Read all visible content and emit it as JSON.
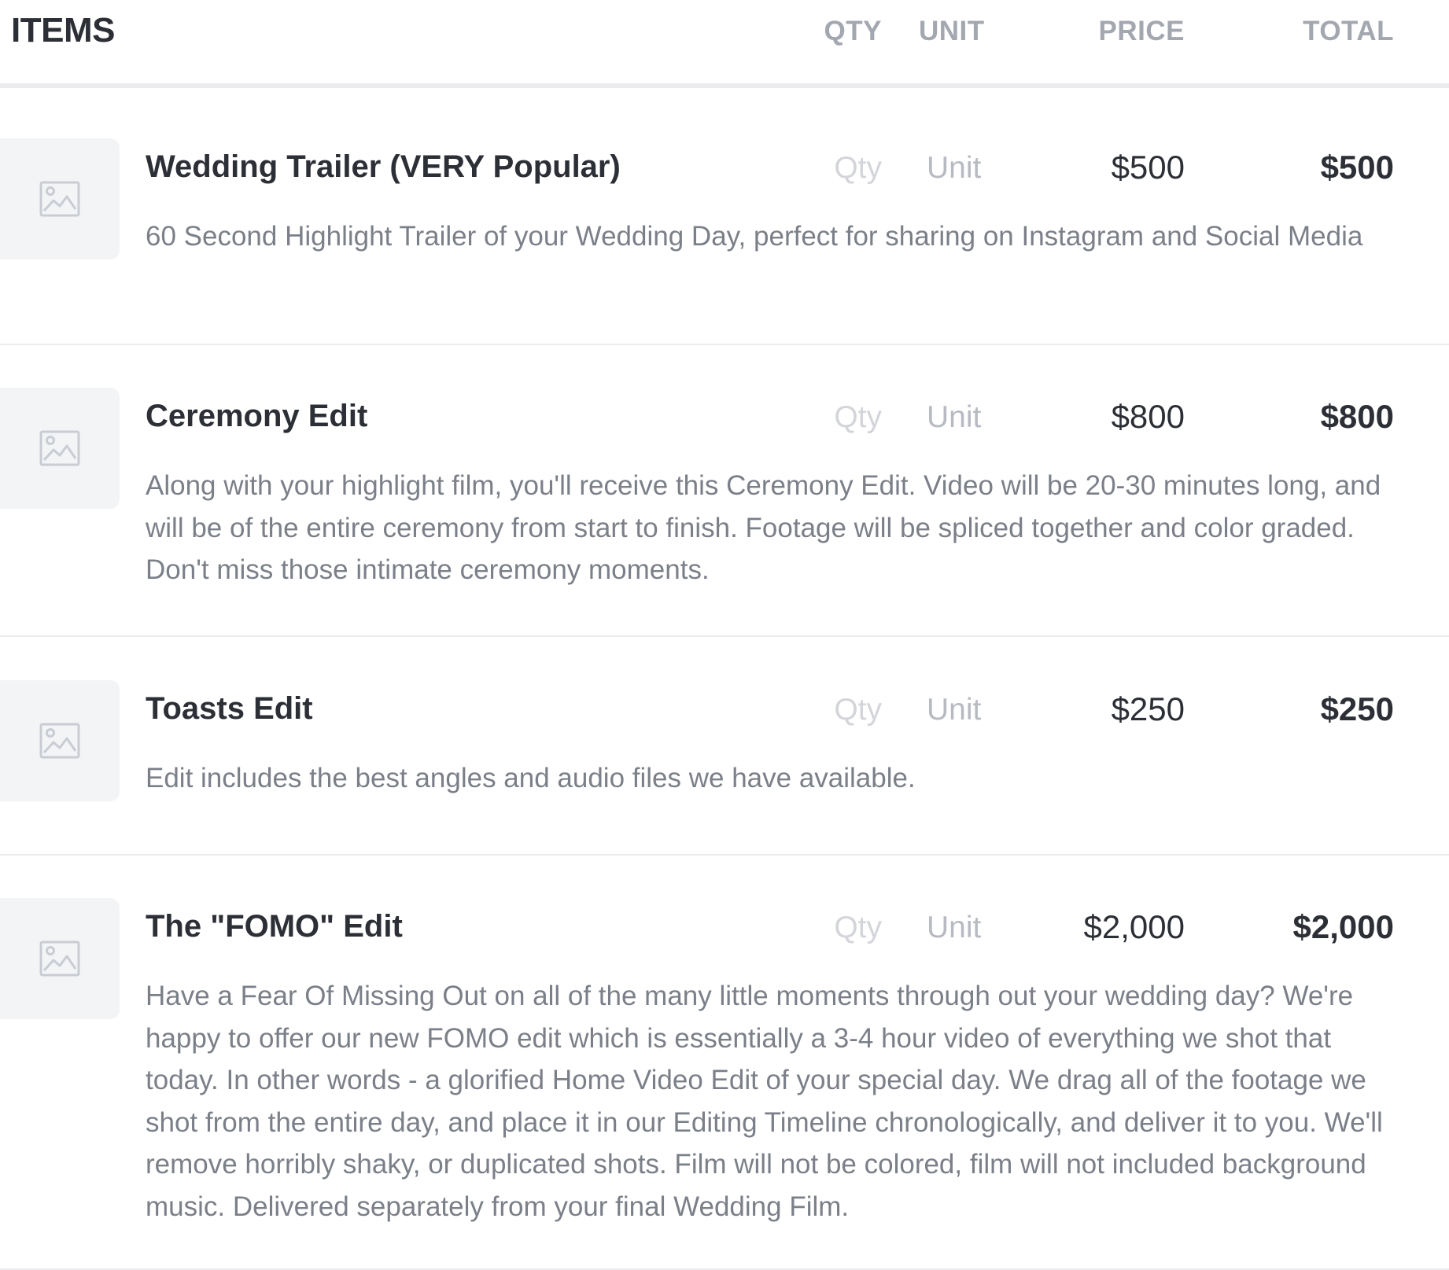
{
  "header": {
    "title": "ITEMS",
    "col_qty": "QTY",
    "col_unit": "UNIT",
    "col_price": "PRICE",
    "col_total": "TOTAL"
  },
  "items": [
    {
      "name": "Wedding Trailer (VERY Popular)",
      "qty_placeholder": "Qty",
      "unit_placeholder": "Unit",
      "price": "$500",
      "total": "$500",
      "description": "60 Second Highlight Trailer of your Wedding Day, perfect for sharing on Instagram and Social Media"
    },
    {
      "name": "Ceremony Edit",
      "qty_placeholder": "Qty",
      "unit_placeholder": "Unit",
      "price": "$800",
      "total": "$800",
      "description": "Along with your highlight film, you'll receive this Ceremony Edit. Video will be 20-30 minutes long, and will be of the entire ceremony from start to finish. Footage will be spliced together and color graded. Don't miss those intimate ceremony moments."
    },
    {
      "name": "Toasts Edit",
      "qty_placeholder": "Qty",
      "unit_placeholder": "Unit",
      "price": "$250",
      "total": "$250",
      "description": "Edit includes the best angles and audio files we have available."
    },
    {
      "name": "The \"FOMO\" Edit",
      "qty_placeholder": "Qty",
      "unit_placeholder": "Unit",
      "price": "$2,000",
      "total": "$2,000",
      "description": "Have a Fear Of Missing Out on all of the many little moments through out your wedding day? We're happy to offer our new FOMO edit which is essentially a 3-4 hour video of everything we shot that today. In other words - a glorified Home Video Edit of your special day. We drag all of the footage we shot from the entire day, and place it in our Editing Timeline chronologically, and deliver it to you. We'll remove horribly shaky, or duplicated shots. Film will not be colored, film will not included background music. Delivered separately from your final Wedding Film."
    }
  ],
  "icons": {
    "thumbnail": "image-placeholder-icon"
  },
  "colors": {
    "text_primary": "#2c2f36",
    "text_secondary": "#7b7f88",
    "header_label": "#a3a7b0",
    "placeholder": "#d3d5da",
    "divider": "#ececef",
    "thumb_bg": "#f3f4f6"
  }
}
